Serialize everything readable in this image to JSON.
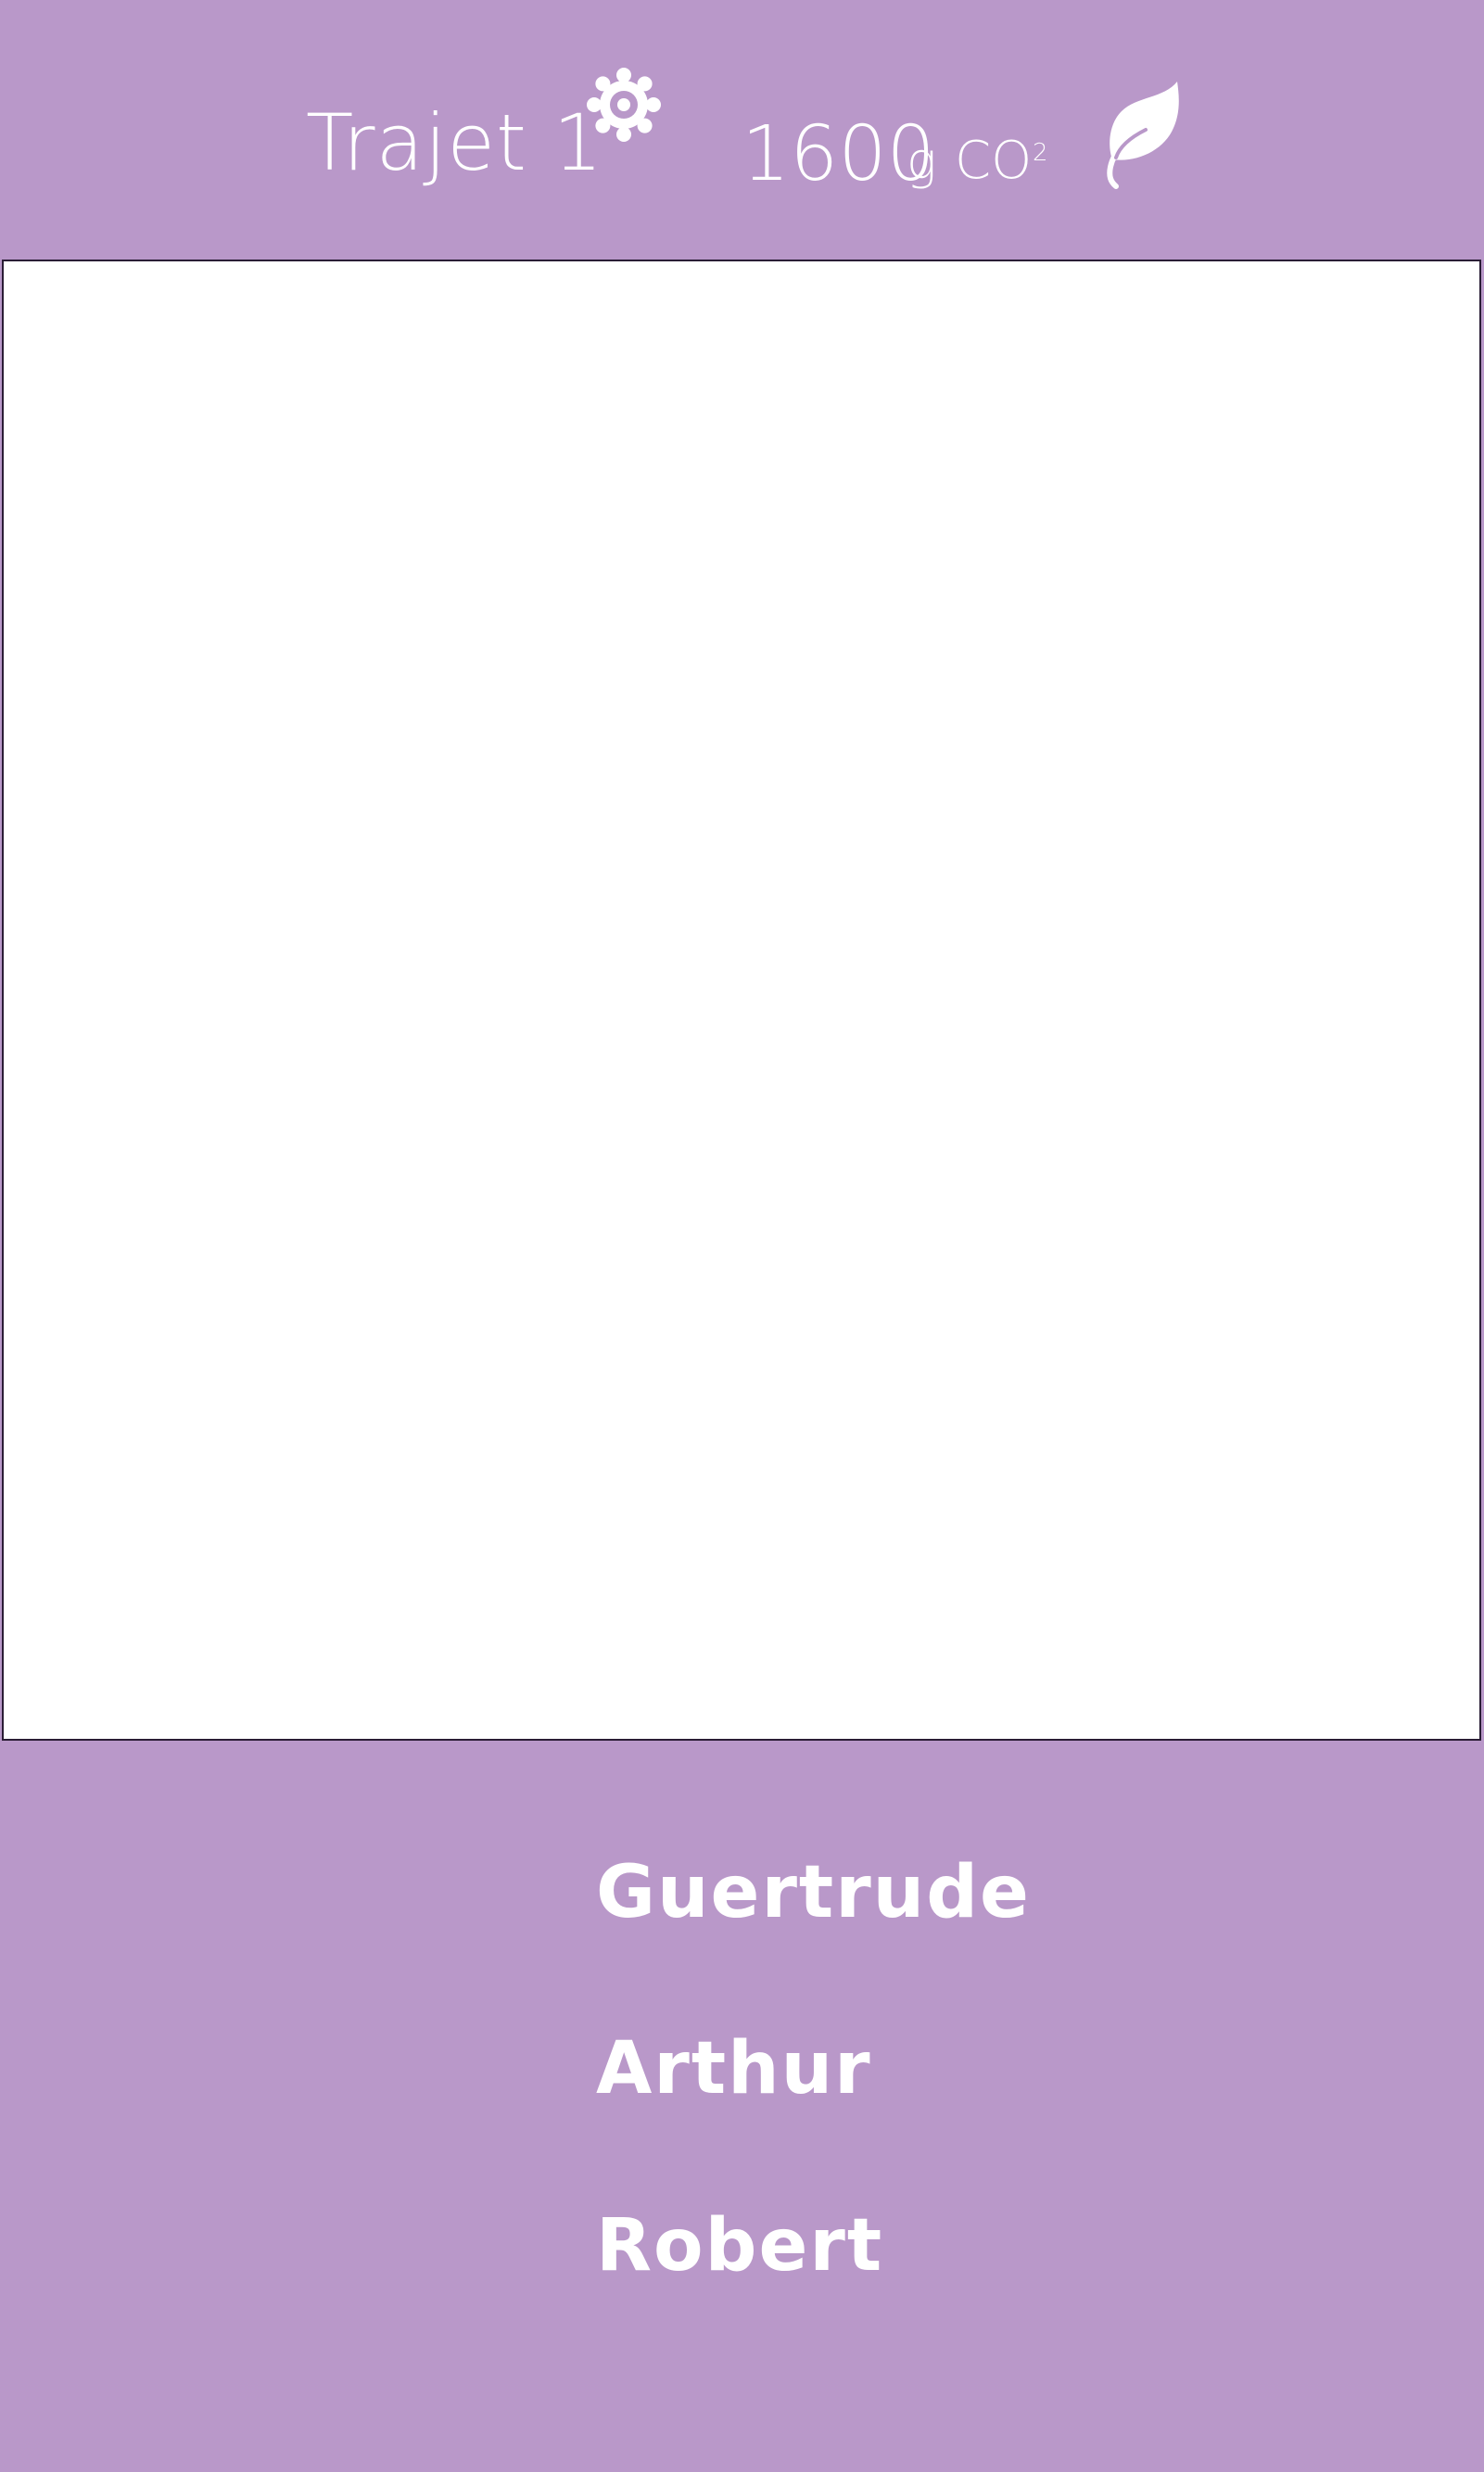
{
  "header": {
    "trip_title": "Trajet 1",
    "emission_value": "1600",
    "emission_unit": "g",
    "emission_gas": "CO",
    "emission_subscript": "2",
    "settings_icon": "gear-icon",
    "eco_icon": "leaf-icon"
  },
  "passengers": [
    {
      "name": "Guertrude"
    },
    {
      "name": "Arthur"
    },
    {
      "name": "Robert"
    }
  ],
  "colors": {
    "background": "#b998c9",
    "text": "#ffffff",
    "map_background": "#ffffff",
    "map_border": "#2a1d35"
  }
}
